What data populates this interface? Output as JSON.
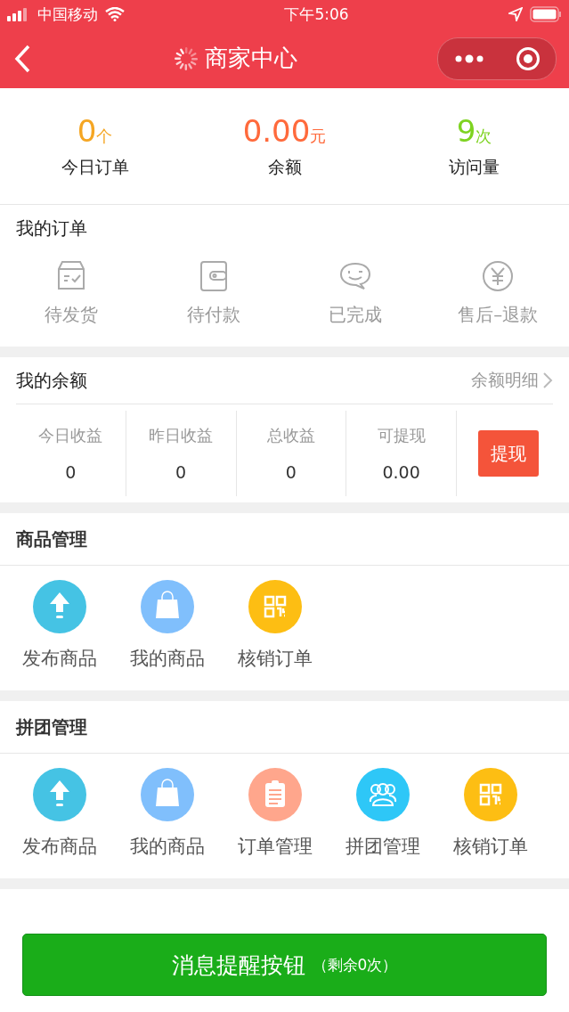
{
  "status_bar": {
    "carrier": "中国移动",
    "time": "下午5:06"
  },
  "nav": {
    "title": "商家中心"
  },
  "stats": [
    {
      "value": "0",
      "unit": "个",
      "label": "今日订单",
      "color": "#f5a623"
    },
    {
      "value": "0.00",
      "unit": "元",
      "label": "余额",
      "color": "#ff6a3c"
    },
    {
      "value": "9",
      "unit": "次",
      "label": "访问量",
      "color": "#7ed321"
    }
  ],
  "orders": {
    "title": "我的订单",
    "items": [
      {
        "kind": "box",
        "label": "待发货"
      },
      {
        "kind": "wallet",
        "label": "待付款"
      },
      {
        "kind": "chat",
        "label": "已完成"
      },
      {
        "kind": "yen",
        "label": "售后–退款"
      }
    ]
  },
  "balance": {
    "title": "我的余额",
    "link": "余额明细",
    "columns": [
      {
        "label": "今日收益",
        "value": "0"
      },
      {
        "label": "昨日收益",
        "value": "0"
      },
      {
        "label": "总收益",
        "value": "0"
      },
      {
        "label": "可提现",
        "value": "0.00"
      }
    ],
    "button": "提现"
  },
  "sections": [
    {
      "title": "商品管理",
      "tools": [
        {
          "kind": "upload",
          "label": "发布商品",
          "color": "#45c3e4"
        },
        {
          "kind": "bag",
          "label": "我的商品",
          "color": "#80bffc"
        },
        {
          "kind": "qr",
          "label": "核销订单",
          "color": "#fdbe13"
        }
      ]
    },
    {
      "title": "拼团管理",
      "tools": [
        {
          "kind": "upload",
          "label": "发布商品",
          "color": "#45c3e4"
        },
        {
          "kind": "bag",
          "label": "我的商品",
          "color": "#80bffc"
        },
        {
          "kind": "clipboard",
          "label": "订单管理",
          "color": "#ffa68c"
        },
        {
          "kind": "group",
          "label": "拼团管理",
          "color": "#2ec7f7"
        },
        {
          "kind": "qr",
          "label": "核销订单",
          "color": "#fdbe13"
        }
      ]
    }
  ],
  "bottom_button": {
    "label": "消息提醒按钮",
    "note": "（剩余0次）"
  }
}
